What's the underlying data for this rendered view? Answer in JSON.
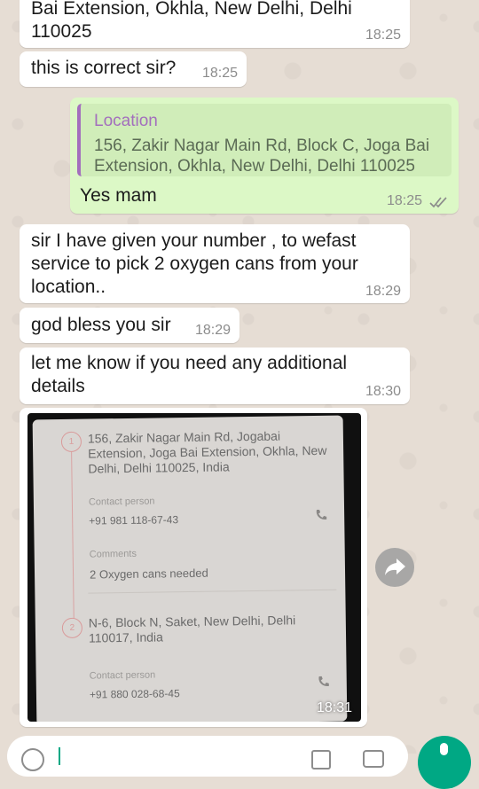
{
  "colors": {
    "incoming": "#ffffff",
    "outgoing": "#dcf8c6",
    "quote_accent": "#a36fbd",
    "tick": "#8c8c8c",
    "fab": "#00a884"
  },
  "messages": [
    {
      "text": "Bai Extension, Okhla, New Delhi, Delhi\n110025",
      "time": "18:25"
    },
    {
      "text": "this is correct sir?",
      "time": "18:25"
    },
    {
      "quote_title": "Location",
      "quote_body": "156, Zakir Nagar Main Rd, Block C, Joga Bai Extension, Okhla, New Delhi, Delhi 110025",
      "text": "Yes mam",
      "time": "18:25",
      "status_icon": "double-check-icon"
    },
    {
      "text": "sir I have given your number , to wefast service to pick 2 oxygen cans from your location..",
      "time": "18:29"
    },
    {
      "text": "god bless you sir",
      "time": "18:29"
    },
    {
      "text": "let me know if you need any additional details",
      "time": "18:30"
    }
  ],
  "photo": {
    "time": "18:31",
    "stop1_num": "1",
    "stop1_address": "156, Zakir Nagar Main Rd, Jogabai Extension, Joga Bai Extension, Okhla, New Delhi, Delhi 110025, India",
    "contact_label": "Contact person",
    "stop1_phone": "+91 981 118-67-43",
    "comments_label": "Comments",
    "comments": "2 Oxygen cans needed",
    "stop2_num": "2",
    "stop2_address": "N-6, Block N, Saket, New Delhi, Delhi 110017, India",
    "stop2_contact_label": "Contact person",
    "stop2_phone": "+91 880 028-68-45"
  }
}
